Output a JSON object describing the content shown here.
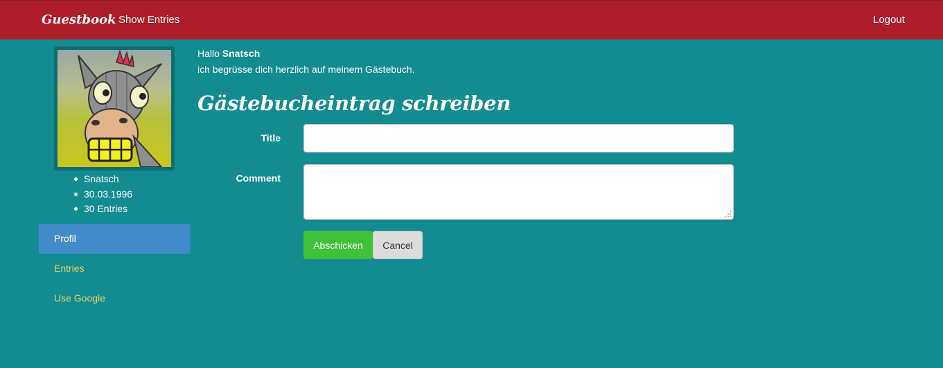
{
  "navbar": {
    "brand": "Guestbook",
    "show_entries": "Show Entries",
    "logout": "Logout"
  },
  "profile": {
    "name": "Snatsch",
    "birthdate": "30.03.1996",
    "entries": "30 Entries"
  },
  "sidebar": {
    "items": [
      {
        "label": "Profil",
        "active": true
      },
      {
        "label": "Entries",
        "active": false
      },
      {
        "label": "Use Google",
        "active": false
      }
    ]
  },
  "main": {
    "greeting_prefix": "Hallo",
    "greeting_name": "Snatsch",
    "welcome": "ich begrüsse dich herzlich auf meinem Gästebuch.",
    "form_title": "Gästebucheintrag schreiben",
    "title_label": "Title",
    "title_value": "",
    "comment_label": "Comment",
    "comment_value": "",
    "submit_label": "Abschicken",
    "cancel_label": "Cancel"
  },
  "colors": {
    "navbar": "#ad1d29",
    "background": "#128b91",
    "active_nav": "#428bca",
    "submit": "#3fc13a",
    "link": "#e6d66b"
  }
}
